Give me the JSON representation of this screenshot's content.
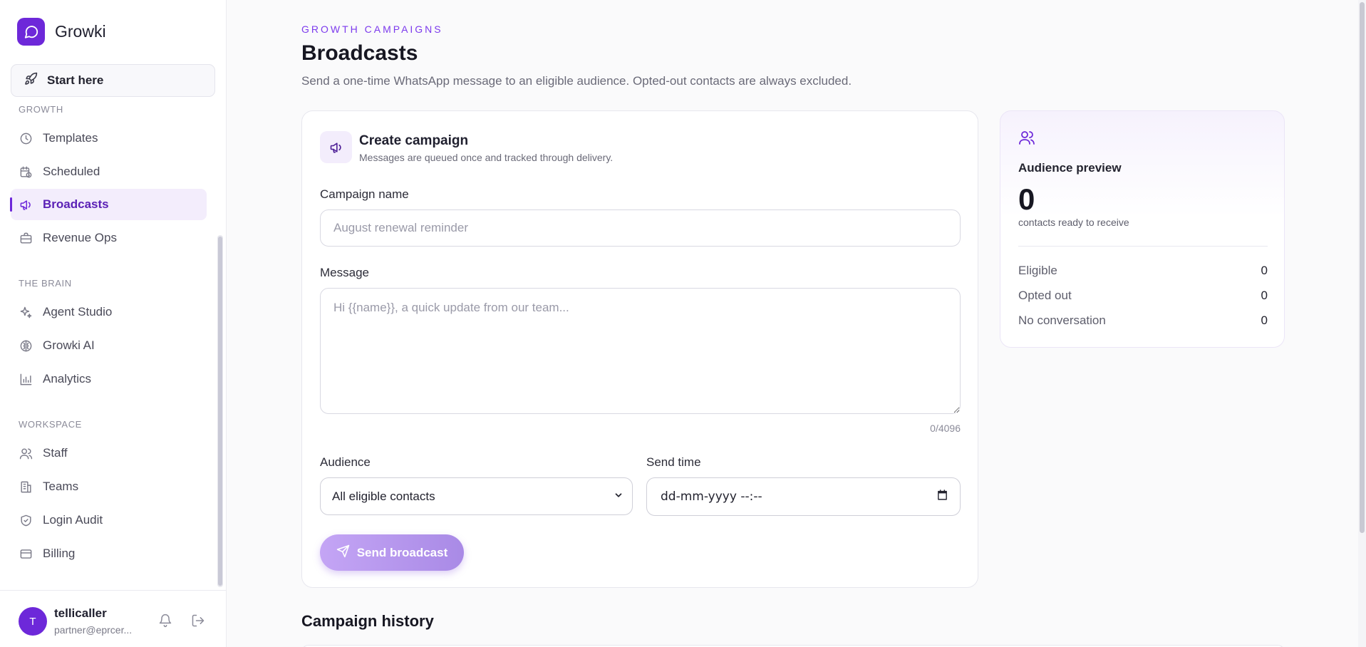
{
  "app": {
    "name": "Growki",
    "accent": "#6d28d9"
  },
  "sidebar": {
    "start_here": "Start here",
    "sections": [
      {
        "title": "GROWTH",
        "items": [
          {
            "label": "Templates",
            "icon": "clock-icon"
          },
          {
            "label": "Scheduled",
            "icon": "calendar-clock-icon"
          },
          {
            "label": "Broadcasts",
            "icon": "megaphone-icon",
            "active": true
          },
          {
            "label": "Revenue Ops",
            "icon": "briefcase-icon"
          }
        ]
      },
      {
        "title": "THE BRAIN",
        "items": [
          {
            "label": "Agent Studio",
            "icon": "sparkles-icon"
          },
          {
            "label": "Growki AI",
            "icon": "brain-icon"
          },
          {
            "label": "Analytics",
            "icon": "bar-chart-icon"
          }
        ]
      },
      {
        "title": "WORKSPACE",
        "items": [
          {
            "label": "Staff",
            "icon": "users-icon"
          },
          {
            "label": "Teams",
            "icon": "building-icon"
          },
          {
            "label": "Login Audit",
            "icon": "shield-check-icon"
          },
          {
            "label": "Billing",
            "icon": "credit-card-icon"
          }
        ]
      }
    ],
    "user": {
      "initial": "T",
      "name": "tellicaller",
      "email": "partner@eprcer..."
    }
  },
  "header": {
    "eyebrow": "GROWTH CAMPAIGNS",
    "title": "Broadcasts",
    "subtitle": "Send a one-time WhatsApp message to an eligible audience. Opted-out contacts are always excluded."
  },
  "create": {
    "title": "Create campaign",
    "subtitle": "Messages are queued once and tracked through delivery.",
    "campaign_name_label": "Campaign name",
    "campaign_name_placeholder": "August renewal reminder",
    "message_label": "Message",
    "message_placeholder": "Hi {{name}}, a quick update from our team...",
    "counter": "0/4096",
    "audience_label": "Audience",
    "audience_value": "All eligible contacts",
    "send_time_label": "Send time",
    "send_time_value": "dd-mm-yyyy --:--",
    "send_button": "Send broadcast"
  },
  "audience_preview": {
    "title": "Audience preview",
    "count": "0",
    "count_label": "contacts ready to receive",
    "rows": [
      {
        "label": "Eligible",
        "value": "0"
      },
      {
        "label": "Opted out",
        "value": "0"
      },
      {
        "label": "No conversation",
        "value": "0"
      }
    ]
  },
  "history": {
    "title": "Campaign history"
  }
}
